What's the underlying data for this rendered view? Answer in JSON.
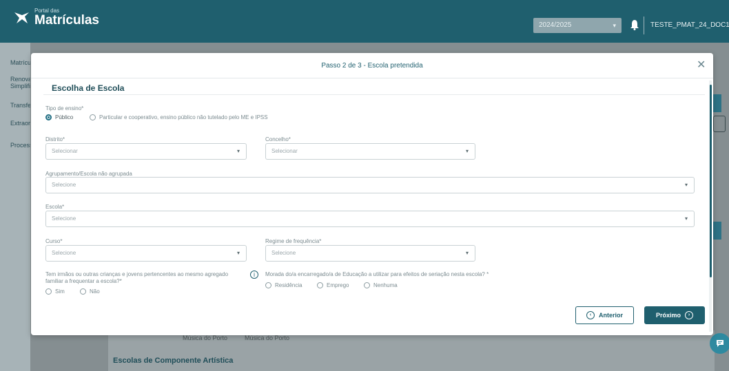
{
  "app": {
    "logo_small": "Portal das",
    "logo_big": "Matrículas",
    "year": "2024/2025",
    "user": "TESTE_PMAT_24_DOC1"
  },
  "sidebar": {
    "items": [
      {
        "label": "Matrículas"
      },
      {
        "label": "Renovação"
      },
      {
        "label": "Simplificado"
      },
      {
        "label": "Transferência"
      },
      {
        "label": "Extraordinária"
      },
      {
        "label": "Processos"
      }
    ]
  },
  "background": {
    "table_cells": [
      "Música do Porto",
      "Música do Porto"
    ],
    "section_title": "Escolas de Componente Artística"
  },
  "modal": {
    "title": "Passo 2 de 3 - Escola pretendida",
    "section_title": "Escolha de Escola",
    "tipo_ensino_label": "Tipo de ensino*",
    "tipo_options": [
      "Público",
      "Particular e cooperativo, ensino público não tutelado pelo ME e IPSS"
    ],
    "distrito_label": "Distrito*",
    "distrito_placeholder": "Selecionar",
    "concelho_label": "Concelho*",
    "concelho_placeholder": "Selecionar",
    "agrupamento_label": "Agrupamento/Escola não agrupada",
    "agrupamento_placeholder": "Selecione",
    "escola_label": "Escola*",
    "escola_placeholder": "Selecione",
    "curso_label": "Curso*",
    "curso_placeholder": "Selecione",
    "regime_label": "Regime de frequência*",
    "regime_placeholder": "Selecione",
    "irmaos_label_1": "Tem irmãos ou outras crianças e jovens pertencentes ao mesmo agregado",
    "irmaos_label_2": "familiar a frequentar a escola?*",
    "irmaos_options": [
      "Sim",
      "Não"
    ],
    "morada_label": "Morada do/a encarregado/a de Educação a utilizar para efeitos de seriação nesta escola? *",
    "morada_options": [
      "Residência",
      "Emprego",
      "Nenhuma"
    ],
    "btn_prev": "Anterior",
    "btn_next": "Próximo"
  }
}
